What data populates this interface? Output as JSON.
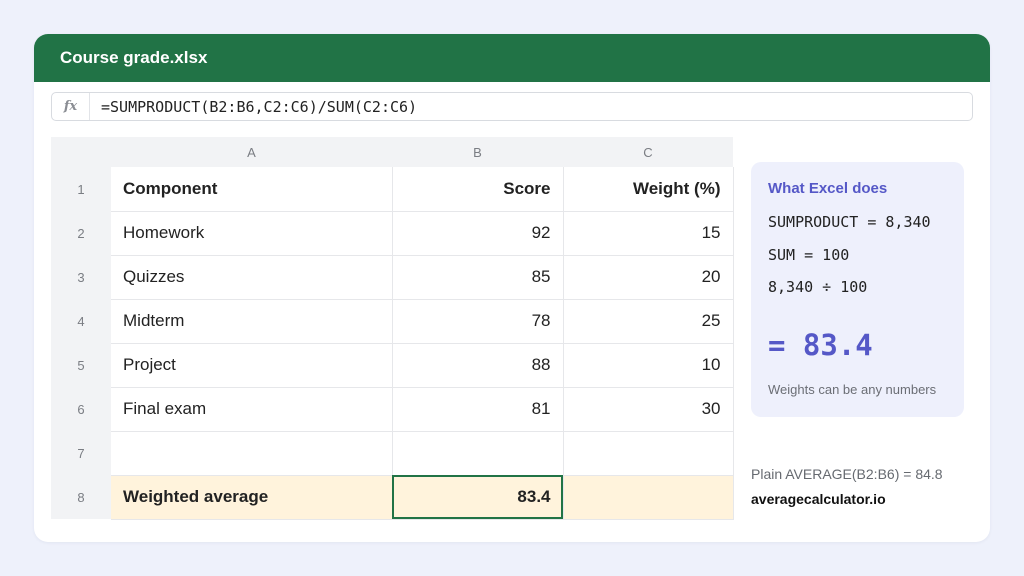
{
  "window": {
    "title": "Course grade.xlsx"
  },
  "formula_bar": {
    "fx_label": "fx",
    "formula": "=SUMPRODUCT(B2:B6,C2:C6)/SUM(C2:C6)"
  },
  "sheet": {
    "columns": [
      "A",
      "B",
      "C"
    ],
    "rows": [
      {
        "num": "1",
        "a": "Component",
        "b": "Score",
        "c": "Weight (%)"
      },
      {
        "num": "2",
        "a": "Homework",
        "b": "92",
        "c": "15"
      },
      {
        "num": "3",
        "a": "Quizzes",
        "b": "85",
        "c": "20"
      },
      {
        "num": "4",
        "a": "Midterm",
        "b": "78",
        "c": "25"
      },
      {
        "num": "5",
        "a": "Project",
        "b": "88",
        "c": "10"
      },
      {
        "num": "6",
        "a": "Final exam",
        "b": "81",
        "c": "30"
      },
      {
        "num": "7",
        "a": "",
        "b": "",
        "c": ""
      },
      {
        "num": "8",
        "a": "Weighted average",
        "b": "83.4",
        "c": ""
      }
    ],
    "selected_cell": "B8"
  },
  "panel": {
    "title": "What Excel does",
    "lines": [
      "SUMPRODUCT = 8,340",
      "SUM = 100",
      "8,340 ÷ 100"
    ],
    "result": "= 83.4",
    "note": "Weights can be any numbers"
  },
  "footer": {
    "plain_average": "Plain AVERAGE(B2:B6) = 84.8",
    "site": "averagecalculator.io"
  },
  "colors": {
    "title_bar": "#217346",
    "accent": "#5558c7",
    "total_row": "#fff3dc",
    "background": "#eef1fb"
  }
}
